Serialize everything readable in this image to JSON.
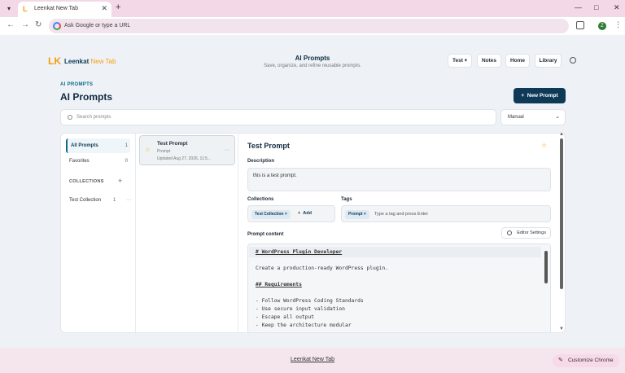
{
  "browser": {
    "tab_title": "Leenkat New Tab",
    "tab_favicon": "L",
    "omnibox_placeholder": "Ask Google or type a URL",
    "profile_initial": "Z"
  },
  "header": {
    "logo_mark": "LK",
    "brand_name": "Leenkat",
    "brand_sub": "New Tab",
    "title": "AI Prompts",
    "subtitle": "Save, organize, and refine reusable prompts.",
    "nav": [
      "Test",
      "Notes",
      "Home",
      "Library"
    ]
  },
  "page": {
    "breadcrumb": "AI PROMPTS",
    "title": "AI Prompts",
    "new_button": "New Prompt",
    "search_placeholder": "Search prompts",
    "sort_value": "Manual"
  },
  "sidebar": {
    "items": [
      {
        "label": "All Prompts",
        "count": "1"
      },
      {
        "label": "Favorites",
        "count": "0"
      }
    ],
    "collections_heading": "COLLECTIONS",
    "collections": [
      {
        "label": "Test Collection",
        "count": "1"
      }
    ]
  },
  "list": {
    "cards": [
      {
        "title": "Test Prompt",
        "type": "Prompt",
        "updated": "Updated Aug 27, 2026, 11:5..."
      }
    ]
  },
  "detail": {
    "title": "Test Prompt",
    "description_label": "Description",
    "description": "this is a test prompt.",
    "collections_label": "Collections",
    "collection_chip": "Test Collection",
    "add_label": "Add",
    "tags_label": "Tags",
    "tag_chip": "Prompt",
    "tag_placeholder": "Type a tag and press Enter",
    "content_label": "Prompt content",
    "editor_settings": "Editor Settings",
    "content_lines": [
      "# WordPress Plugin Developer",
      "",
      "Create a production-ready WordPress plugin.",
      "",
      "## Requirements",
      "",
      "- Follow WordPress Coding Standards",
      "- Use secure input validation",
      "- Escape all output",
      "- Keep the architecture modular"
    ]
  },
  "footer": {
    "link": "Leenkat New Tab",
    "customize": "Customize Chrome"
  }
}
